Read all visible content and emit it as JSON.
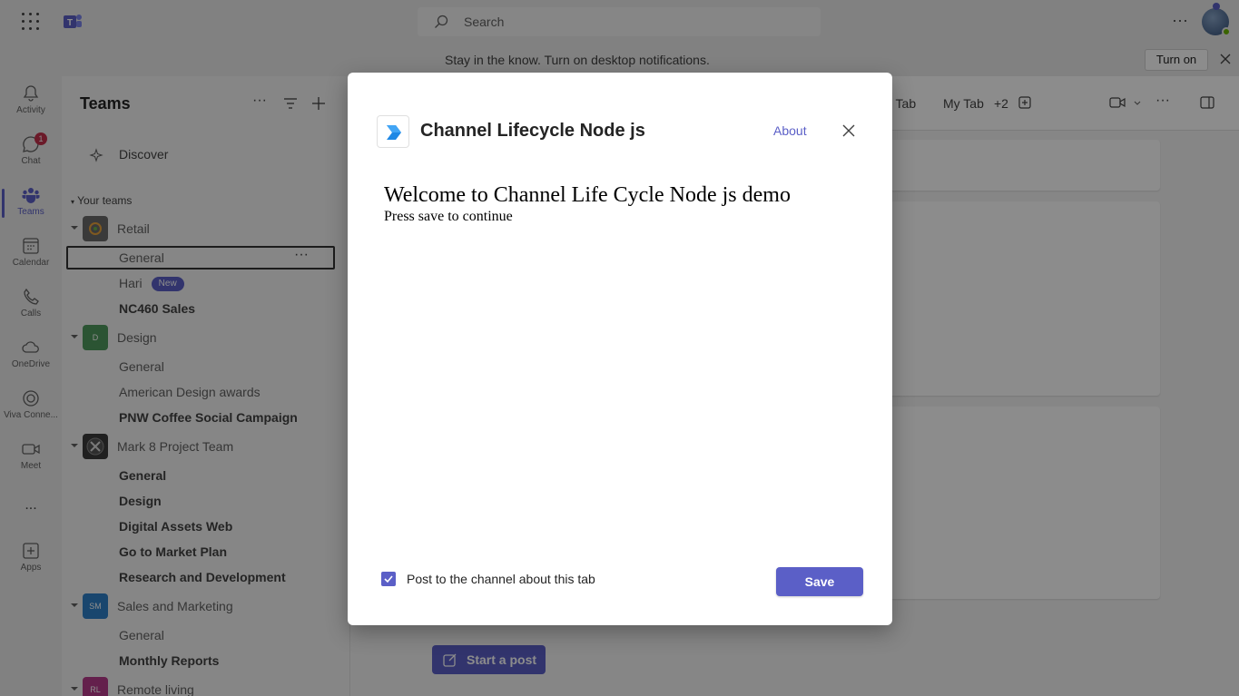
{
  "app": {
    "search_placeholder": "Search"
  },
  "banner": {
    "text": "Stay in the know. Turn on desktop notifications.",
    "turn_on_label": "Turn on"
  },
  "rail": {
    "items": [
      {
        "label": "Activity",
        "icon": "bell-icon"
      },
      {
        "label": "Chat",
        "icon": "chat-icon",
        "badge": "1"
      },
      {
        "label": "Teams",
        "icon": "teams-icon"
      },
      {
        "label": "Calendar",
        "icon": "calendar-icon"
      },
      {
        "label": "Calls",
        "icon": "phone-icon"
      },
      {
        "label": "OneDrive",
        "icon": "cloud-icon"
      },
      {
        "label": "Viva Conne...",
        "icon": "viva-icon"
      },
      {
        "label": "Meet",
        "icon": "video-icon"
      },
      {
        "label": "Apps",
        "icon": "add-apps-icon"
      }
    ],
    "more_label": "..."
  },
  "panel": {
    "title": "Teams",
    "discover_label": "Discover",
    "your_teams_label": "Your teams",
    "teams": [
      {
        "name": "Retail",
        "initials": "",
        "color": "#6b6b6b",
        "channels": [
          {
            "name": "General",
            "bold": false,
            "selected": true
          },
          {
            "name": "Hari",
            "bold": false,
            "badge": "New"
          },
          {
            "name": "NC460 Sales",
            "bold": true
          }
        ]
      },
      {
        "name": "Design",
        "initials": "D",
        "color": "#4f9a5d",
        "channels": [
          {
            "name": "General",
            "bold": false
          },
          {
            "name": "American Design awards",
            "bold": false
          },
          {
            "name": "PNW Coffee Social Campaign",
            "bold": true
          }
        ]
      },
      {
        "name": "Mark 8 Project Team",
        "initials": "",
        "color": "#3b3b3b",
        "channels": [
          {
            "name": "General",
            "bold": true
          },
          {
            "name": "Design",
            "bold": true
          },
          {
            "name": "Digital Assets Web",
            "bold": true
          },
          {
            "name": "Go to Market Plan",
            "bold": true
          },
          {
            "name": "Research and Development",
            "bold": true
          }
        ]
      },
      {
        "name": "Sales and Marketing",
        "initials": "SM",
        "color": "#2f80c8",
        "channels": [
          {
            "name": "General",
            "bold": false
          },
          {
            "name": "Monthly Reports",
            "bold": true
          }
        ]
      },
      {
        "name": "Remote living",
        "initials": "RL",
        "color": "#b73b8a",
        "channels": []
      }
    ]
  },
  "main": {
    "tabs": [
      "el Tab",
      "My Tab",
      "+2"
    ],
    "start_post_label": "Start a post"
  },
  "dialog": {
    "title": "Channel Lifecycle Node js",
    "about_label": "About",
    "heading": "Welcome to Channel Life Cycle Node js demo",
    "subtext": "Press save to continue",
    "checkbox_label": "Post to the channel about this tab",
    "checkbox_checked": true,
    "save_label": "Save"
  },
  "colors": {
    "accent": "#5b5fc7"
  }
}
